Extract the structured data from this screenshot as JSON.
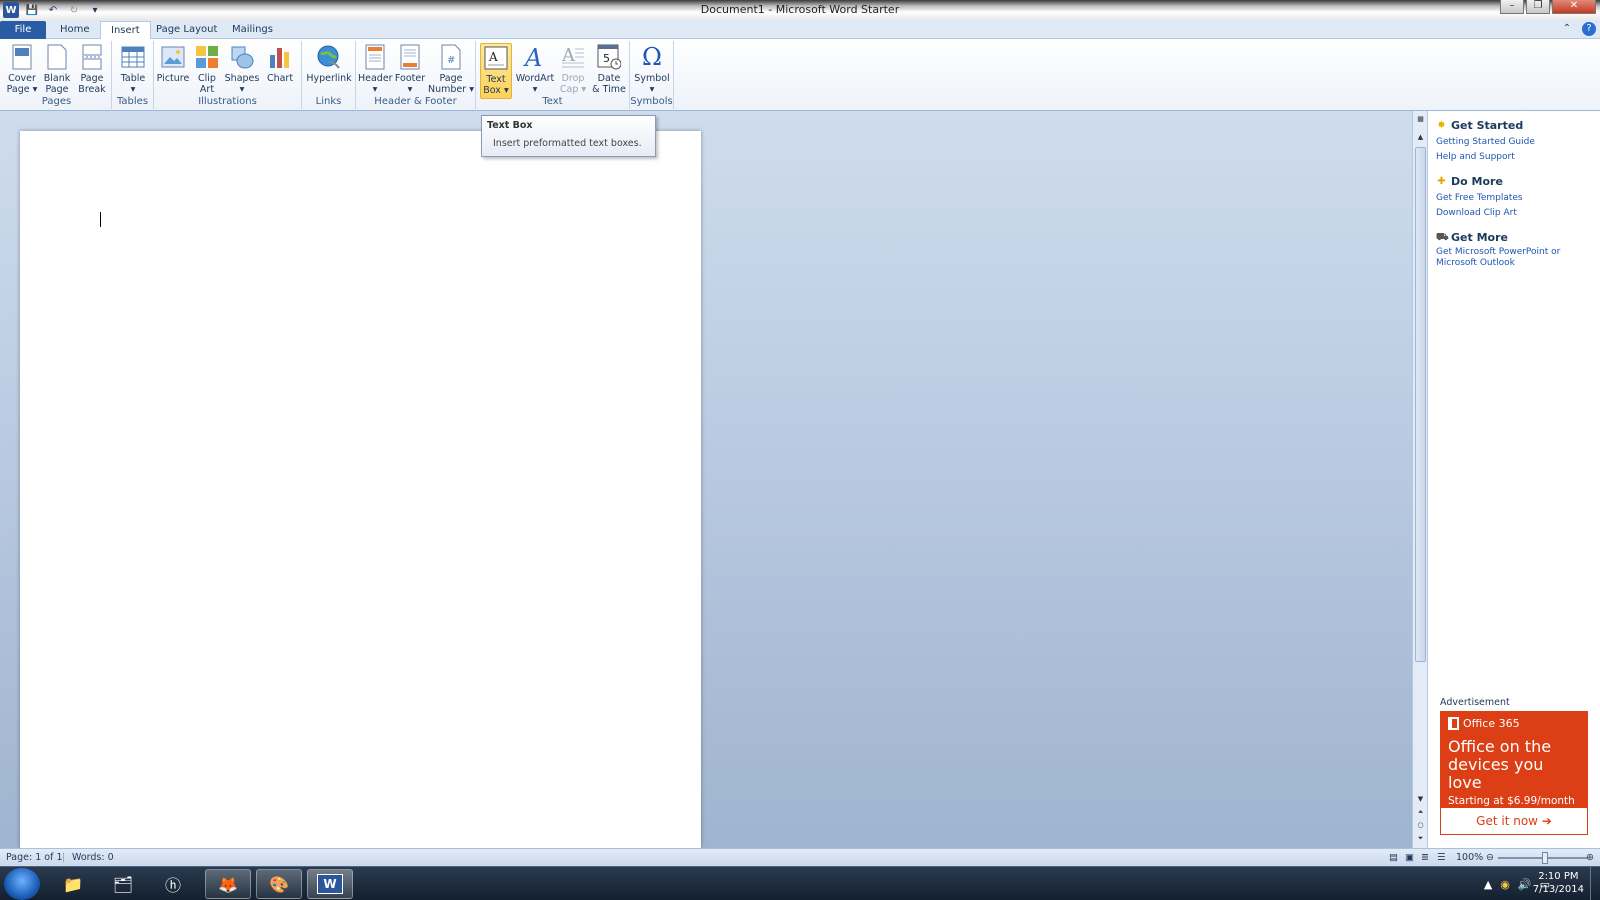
{
  "window": {
    "title": "Document1  -  Microsoft Word Starter"
  },
  "tabs": [
    {
      "label": "File"
    },
    {
      "label": "Home"
    },
    {
      "label": "Insert"
    },
    {
      "label": "Page Layout"
    },
    {
      "label": "Mailings"
    }
  ],
  "ribbon": {
    "groups": {
      "pages": "Pages",
      "tables": "Tables",
      "illustrations": "Illustrations",
      "links": "Links",
      "header_footer": "Header & Footer",
      "text": "Text",
      "symbols": "Symbols"
    },
    "buttons": {
      "cover_page": [
        "Cover",
        "Page ▾"
      ],
      "blank_page": [
        "Blank",
        "Page"
      ],
      "page_break": [
        "Page",
        "Break"
      ],
      "table": [
        "Table",
        "▾"
      ],
      "picture": [
        "Picture",
        ""
      ],
      "clip_art": [
        "Clip",
        "Art"
      ],
      "shapes": [
        "Shapes",
        "▾"
      ],
      "chart": [
        "Chart",
        ""
      ],
      "hyperlink": [
        "Hyperlink",
        ""
      ],
      "header": [
        "Header",
        "▾"
      ],
      "footer": [
        "Footer",
        "▾"
      ],
      "page_number": [
        "Page",
        "Number ▾"
      ],
      "text_box": [
        "Text",
        "Box ▾"
      ],
      "wordart": [
        "WordArt",
        "▾"
      ],
      "drop_cap": [
        "Drop",
        "Cap ▾"
      ],
      "date_time": [
        "Date",
        "& Time"
      ],
      "symbol": [
        "Symbol",
        "▾"
      ]
    }
  },
  "tooltip": {
    "title": "Text Box",
    "description": "Insert preformatted text boxes."
  },
  "taskpane": {
    "sections": [
      {
        "heading": "Get Started",
        "links": [
          "Getting Started Guide",
          "Help and Support"
        ]
      },
      {
        "heading": "Do More",
        "links": [
          "Get Free Templates",
          "Download Clip Art"
        ]
      },
      {
        "heading": "Get More",
        "links": [
          "Get Microsoft PowerPoint or Microsoft Outlook"
        ]
      }
    ],
    "ad": {
      "label": "Advertisement",
      "brand": "Office 365",
      "headline": "Office on the devices you love",
      "price": "Starting at $6.99/month",
      "cta": "Get it now ➔"
    }
  },
  "status": {
    "page": "Page: 1 of 1",
    "words": "Words: 0",
    "zoom": "100%",
    "zoom_level": 1.0
  },
  "taskbar": {
    "time": "2:10 PM",
    "date": "7/13/2014"
  },
  "colors": {
    "accent": "#2a5ca6",
    "ad": "#dc3e15",
    "link": "#1f55b4"
  }
}
